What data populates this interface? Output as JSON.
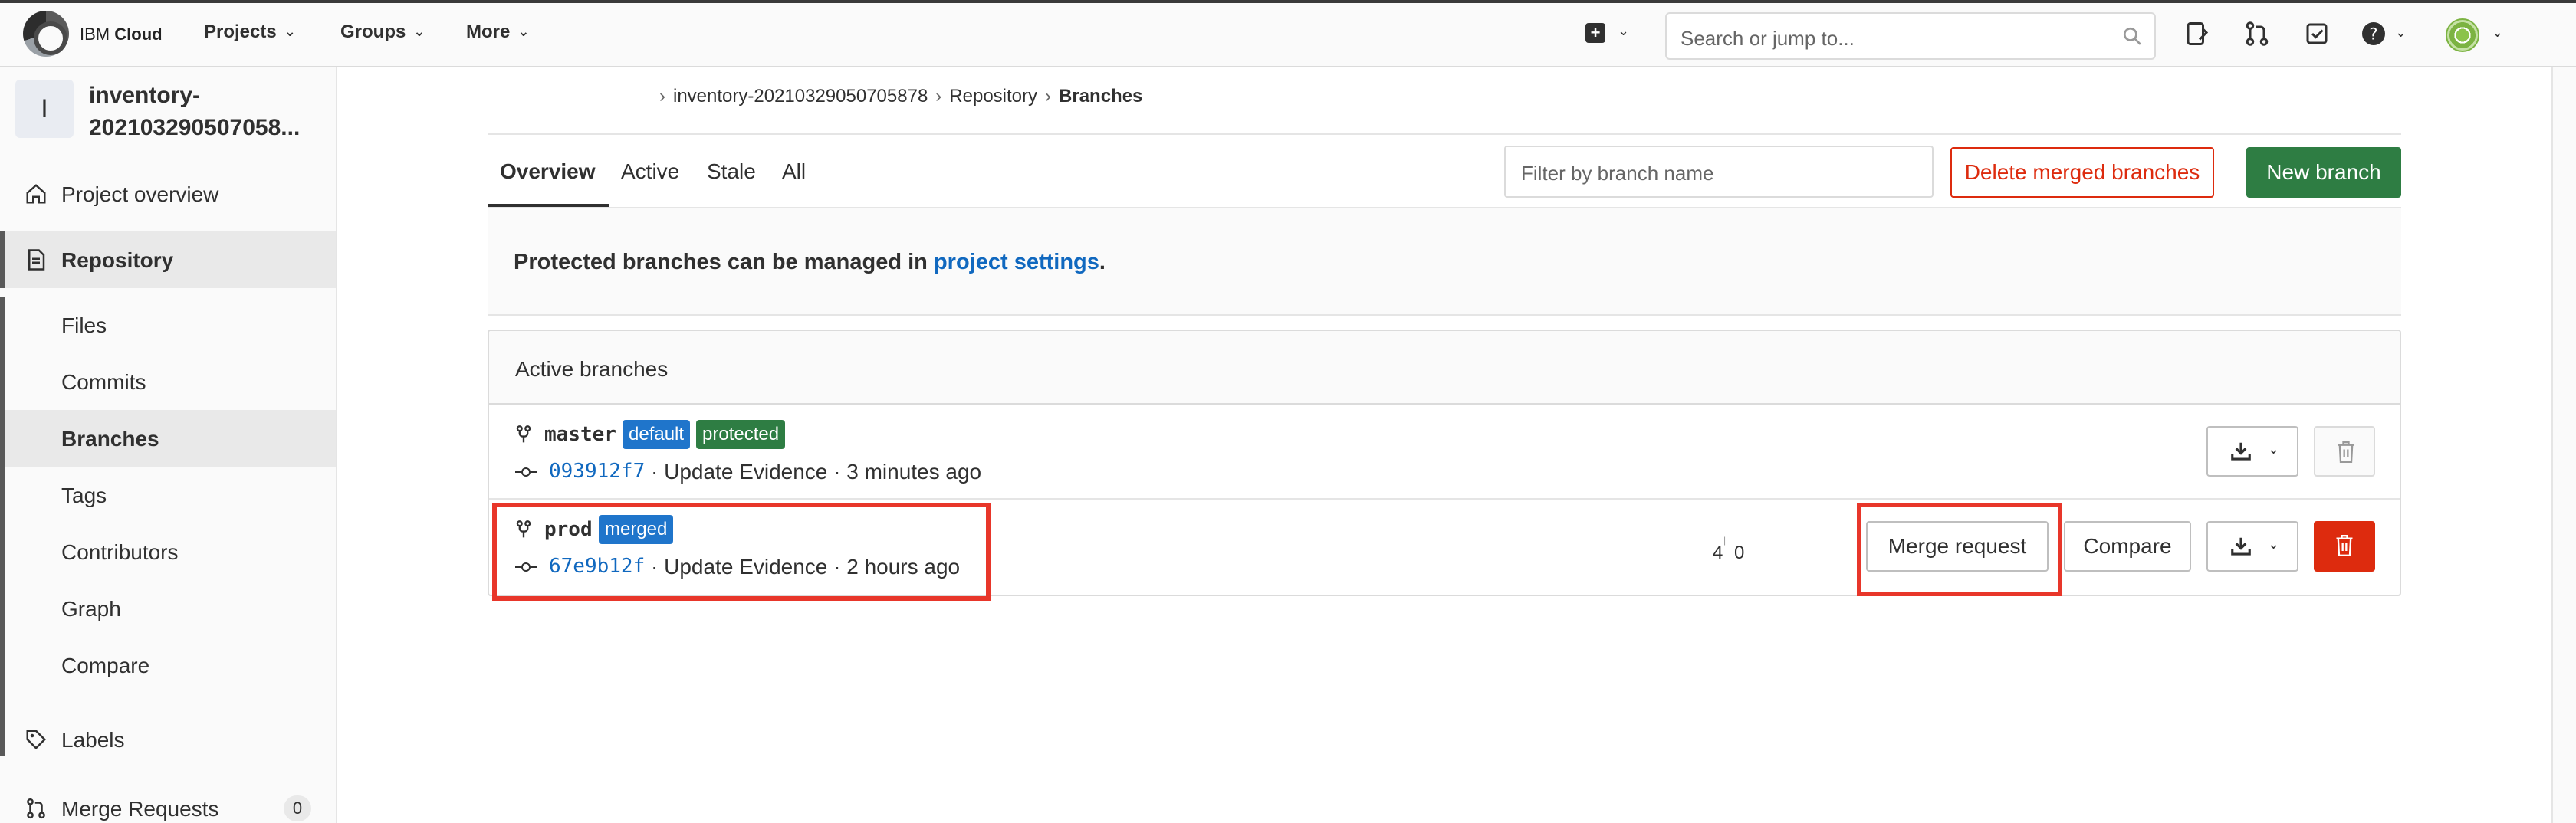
{
  "topbar": {
    "brand_prefix": "IBM",
    "brand_name": "Cloud",
    "nav": [
      {
        "label": "Projects"
      },
      {
        "label": "Groups"
      },
      {
        "label": "More"
      }
    ],
    "search_placeholder": "Search or jump to..."
  },
  "sidebar": {
    "project_initial": "I",
    "project_name": "inventory-202103290507058...",
    "items": {
      "project_overview": "Project overview",
      "repository": "Repository",
      "labels": "Labels",
      "merge_requests": "Merge Requests",
      "merge_requests_count": "0"
    },
    "repository_sub": [
      {
        "label": "Files"
      },
      {
        "label": "Commits"
      },
      {
        "label": "Branches"
      },
      {
        "label": "Tags"
      },
      {
        "label": "Contributors"
      },
      {
        "label": "Graph"
      },
      {
        "label": "Compare"
      }
    ]
  },
  "breadcrumb": {
    "sep": "›",
    "project": "inventory-20210329050705878",
    "section": "Repository",
    "current": "Branches"
  },
  "tabs": [
    {
      "label": "Overview"
    },
    {
      "label": "Active"
    },
    {
      "label": "Stale"
    },
    {
      "label": "All"
    }
  ],
  "filter_placeholder": "Filter by branch name",
  "buttons": {
    "delete_merged": "Delete merged branches",
    "new_branch": "New branch",
    "merge_request": "Merge request",
    "compare": "Compare"
  },
  "notice": {
    "text": "Protected branches can be managed in ",
    "link": "project settings",
    "end": "."
  },
  "active_branches": {
    "title": "Active branches",
    "rows": [
      {
        "name": "master",
        "badges": [
          "default",
          "protected"
        ],
        "sha": "093912f7",
        "meta": "· Update Evidence · 3 minutes ago"
      },
      {
        "name": "prod",
        "badges": [
          "merged"
        ],
        "sha": "67e9b12f",
        "meta": "· Update Evidence · 2 hours ago",
        "behind": "4",
        "ahead": "0"
      }
    ]
  },
  "colors": {
    "danger": "#dd2b0e",
    "success": "#2e7d43",
    "link": "#1068bf",
    "badge_blue": "#1f75cb",
    "highlight": "#e8362a"
  }
}
